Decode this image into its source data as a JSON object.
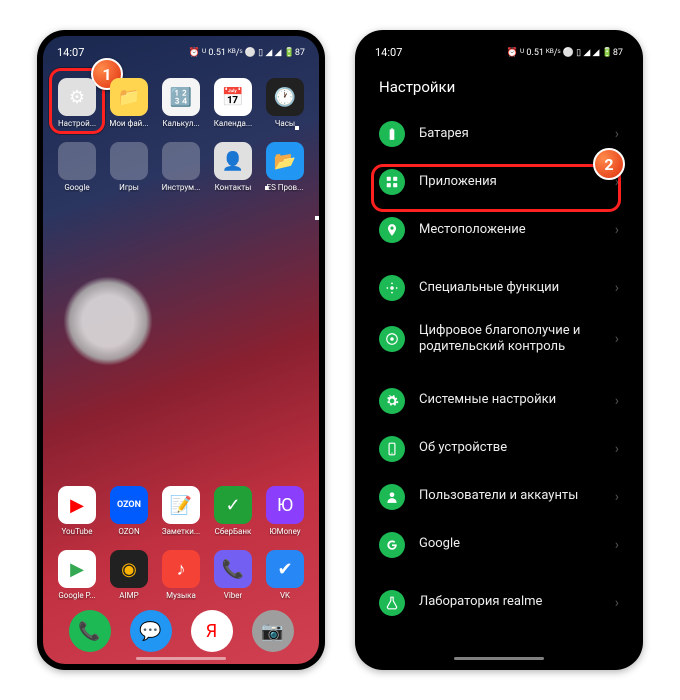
{
  "left": {
    "statusbar": {
      "time": "14:07",
      "icons": "⏰ ᵁ 0.51 ᴷᴮ/ˢ ⚪ ▯ ◢ ◢ 🔋87"
    },
    "apps_row1": [
      {
        "label": "Настрой...",
        "color": "#e0e0e0",
        "glyph": "⚙"
      },
      {
        "label": "Мои фай...",
        "color": "#ffd54f",
        "glyph": "📁"
      },
      {
        "label": "Калькул...",
        "color": "#f5f5f5",
        "glyph": "🔢"
      },
      {
        "label": "Календа...",
        "color": "#ffffff",
        "glyph": "📅"
      },
      {
        "label": "Часы",
        "color": "#212121",
        "glyph": "🕐"
      }
    ],
    "apps_row2": [
      {
        "label": "Google",
        "folder": true
      },
      {
        "label": "Игры",
        "folder": true
      },
      {
        "label": "Инструм...",
        "folder": true
      },
      {
        "label": "Контакты",
        "color": "#e0e0e0",
        "glyph": "👤"
      },
      {
        "label": "ES Пров...",
        "color": "#2196f3",
        "glyph": "📂"
      }
    ],
    "apps_row3": [
      {
        "label": "YouTube",
        "color": "#ffffff",
        "glyph": "▶",
        "fg": "#ff0000"
      },
      {
        "label": "OZON",
        "color": "#005bff",
        "glyph": "OZON",
        "text": true
      },
      {
        "label": "Заметки...",
        "color": "#ffffff",
        "glyph": "📝"
      },
      {
        "label": "СберБанк",
        "color": "#21a038",
        "glyph": "✓"
      },
      {
        "label": "ЮMoney",
        "color": "#8b3ffd",
        "glyph": "Ю"
      }
    ],
    "apps_row4": [
      {
        "label": "Google P...",
        "color": "#ffffff",
        "glyph": "▶",
        "fg": "#34a853"
      },
      {
        "label": "AIMP",
        "color": "#212121",
        "glyph": "◉",
        "fg": "#ffb300"
      },
      {
        "label": "Музыка",
        "color": "#f44336",
        "glyph": "♪"
      },
      {
        "label": "Viber",
        "color": "#7360f2",
        "glyph": "📞"
      },
      {
        "label": "VK",
        "color": "#2787f5",
        "glyph": "✔"
      }
    ],
    "dock": [
      {
        "color": "#1db954",
        "glyph": "📞"
      },
      {
        "color": "#2196f3",
        "glyph": "💬"
      },
      {
        "color": "#ffffff",
        "glyph": "Я",
        "fg": "#ff0000"
      },
      {
        "color": "#9e9e9e",
        "glyph": "📷"
      }
    ],
    "badge": "1"
  },
  "right": {
    "statusbar": {
      "time": "14:07",
      "icons": "⏰ ᵁ 0.51 ᴷᴮ/ˢ ⚪ ▯ ◢ ◢ 🔋87"
    },
    "title": "Настройки",
    "groups": [
      [
        {
          "label": "Батарея",
          "icon": "battery"
        },
        {
          "label": "Приложения",
          "icon": "apps",
          "highlighted": true
        },
        {
          "label": "Местоположение",
          "icon": "location"
        }
      ],
      [
        {
          "label": "Специальные функции",
          "icon": "star"
        },
        {
          "label": "Цифровое благополучие и родительский контроль",
          "icon": "wellbeing"
        }
      ],
      [
        {
          "label": "Системные настройки",
          "icon": "gear"
        },
        {
          "label": "Об устройстве",
          "icon": "about"
        },
        {
          "label": "Пользователи и аккаунты",
          "icon": "user"
        },
        {
          "label": "Google",
          "icon": "google"
        }
      ],
      [
        {
          "label": "Лаборатория realme",
          "icon": "lab"
        }
      ]
    ],
    "badge": "2"
  }
}
